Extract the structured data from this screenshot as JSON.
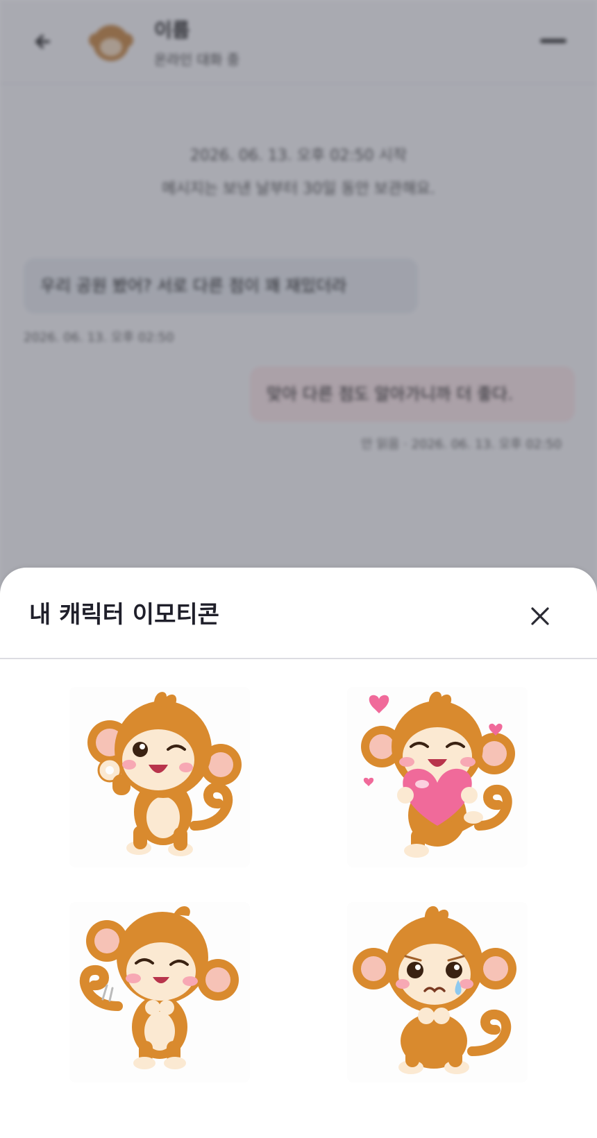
{
  "header": {
    "name": "이름",
    "status": "온라인 대화 중"
  },
  "system": {
    "line1": "2026. 06. 13. 오후 02:50 시작",
    "line2": "메시지는 보낸 날부터 30일 동안 보관해요."
  },
  "messages": [
    {
      "text": "우리 공원 봤어? 서로 다른 점이 꽤 재밌더라",
      "meta": "2026. 06. 13. 오후 02:50"
    },
    {
      "text": "맞아 다른 점도 알아가니까 더 좋다.",
      "meta": "안 읽음 · 2026. 06. 13. 오후 02:50"
    }
  ],
  "sheet": {
    "title": "내 캐릭터 이모티콘",
    "close_icon": "close-icon",
    "emoticons": [
      {
        "name": "monkey-ok-wink",
        "icon": "monkey-ok-sticker"
      },
      {
        "name": "monkey-heart-hug",
        "icon": "monkey-heart-sticker"
      },
      {
        "name": "monkey-giggle",
        "icon": "monkey-giggle-sticker"
      },
      {
        "name": "monkey-sad-tear",
        "icon": "monkey-sad-sticker"
      }
    ]
  },
  "colors": {
    "monkey_fur": "#d98a2e",
    "monkey_face": "#fbe9d2",
    "heart_pink": "#f06a9a",
    "overlay": "#3a3c4a"
  }
}
